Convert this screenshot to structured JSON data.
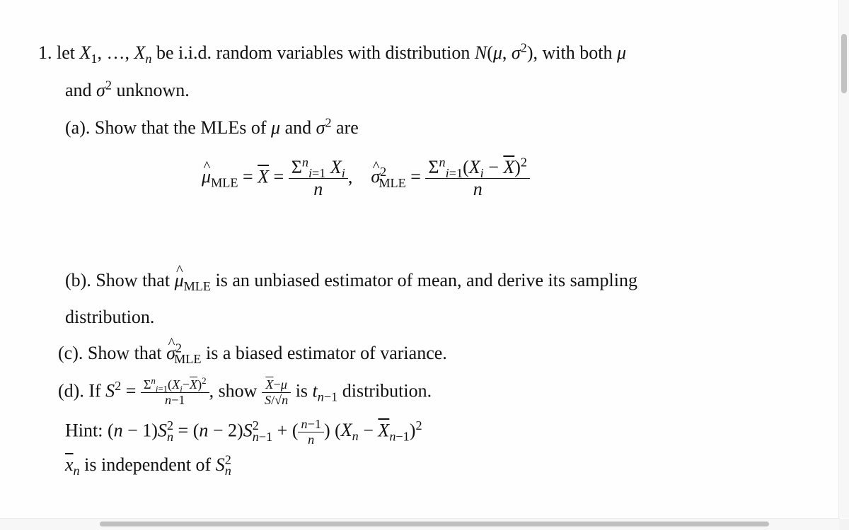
{
  "problem": {
    "number": "1.",
    "intro_line1_a": "let",
    "intro_vars": "X",
    "intro_line1_b": "be i.i.d. random variables with distribution",
    "intro_line1_c": ", with both",
    "intro_line2": "unknown.",
    "and_word": "and"
  },
  "part_a": {
    "label": "(a).",
    "text": "Show that the MLEs of",
    "and_word": "and",
    "are_word": "are",
    "mle_sub": "MLE",
    "mu_formula_num": "X",
    "sigma_formula_num": "(X",
    "denominator": "n"
  },
  "part_b": {
    "label": "(b).",
    "text_a": "Show that",
    "text_b": "is an unbiased estimator of mean, and derive its sampling",
    "text_c": "distribution."
  },
  "part_c": {
    "label": "(c).",
    "text_a": "Show that",
    "text_b": "is a biased estimator of variance."
  },
  "part_d": {
    "label": "(d).",
    "text_a": "If",
    "text_b": ", show",
    "text_c": "is",
    "text_d": "distribution."
  },
  "hint": {
    "label": "Hint:",
    "line2_b": "is independent of"
  },
  "scrollbars": {
    "vertical_position": 0.05,
    "horizontal_visible_fraction": 0.8
  }
}
